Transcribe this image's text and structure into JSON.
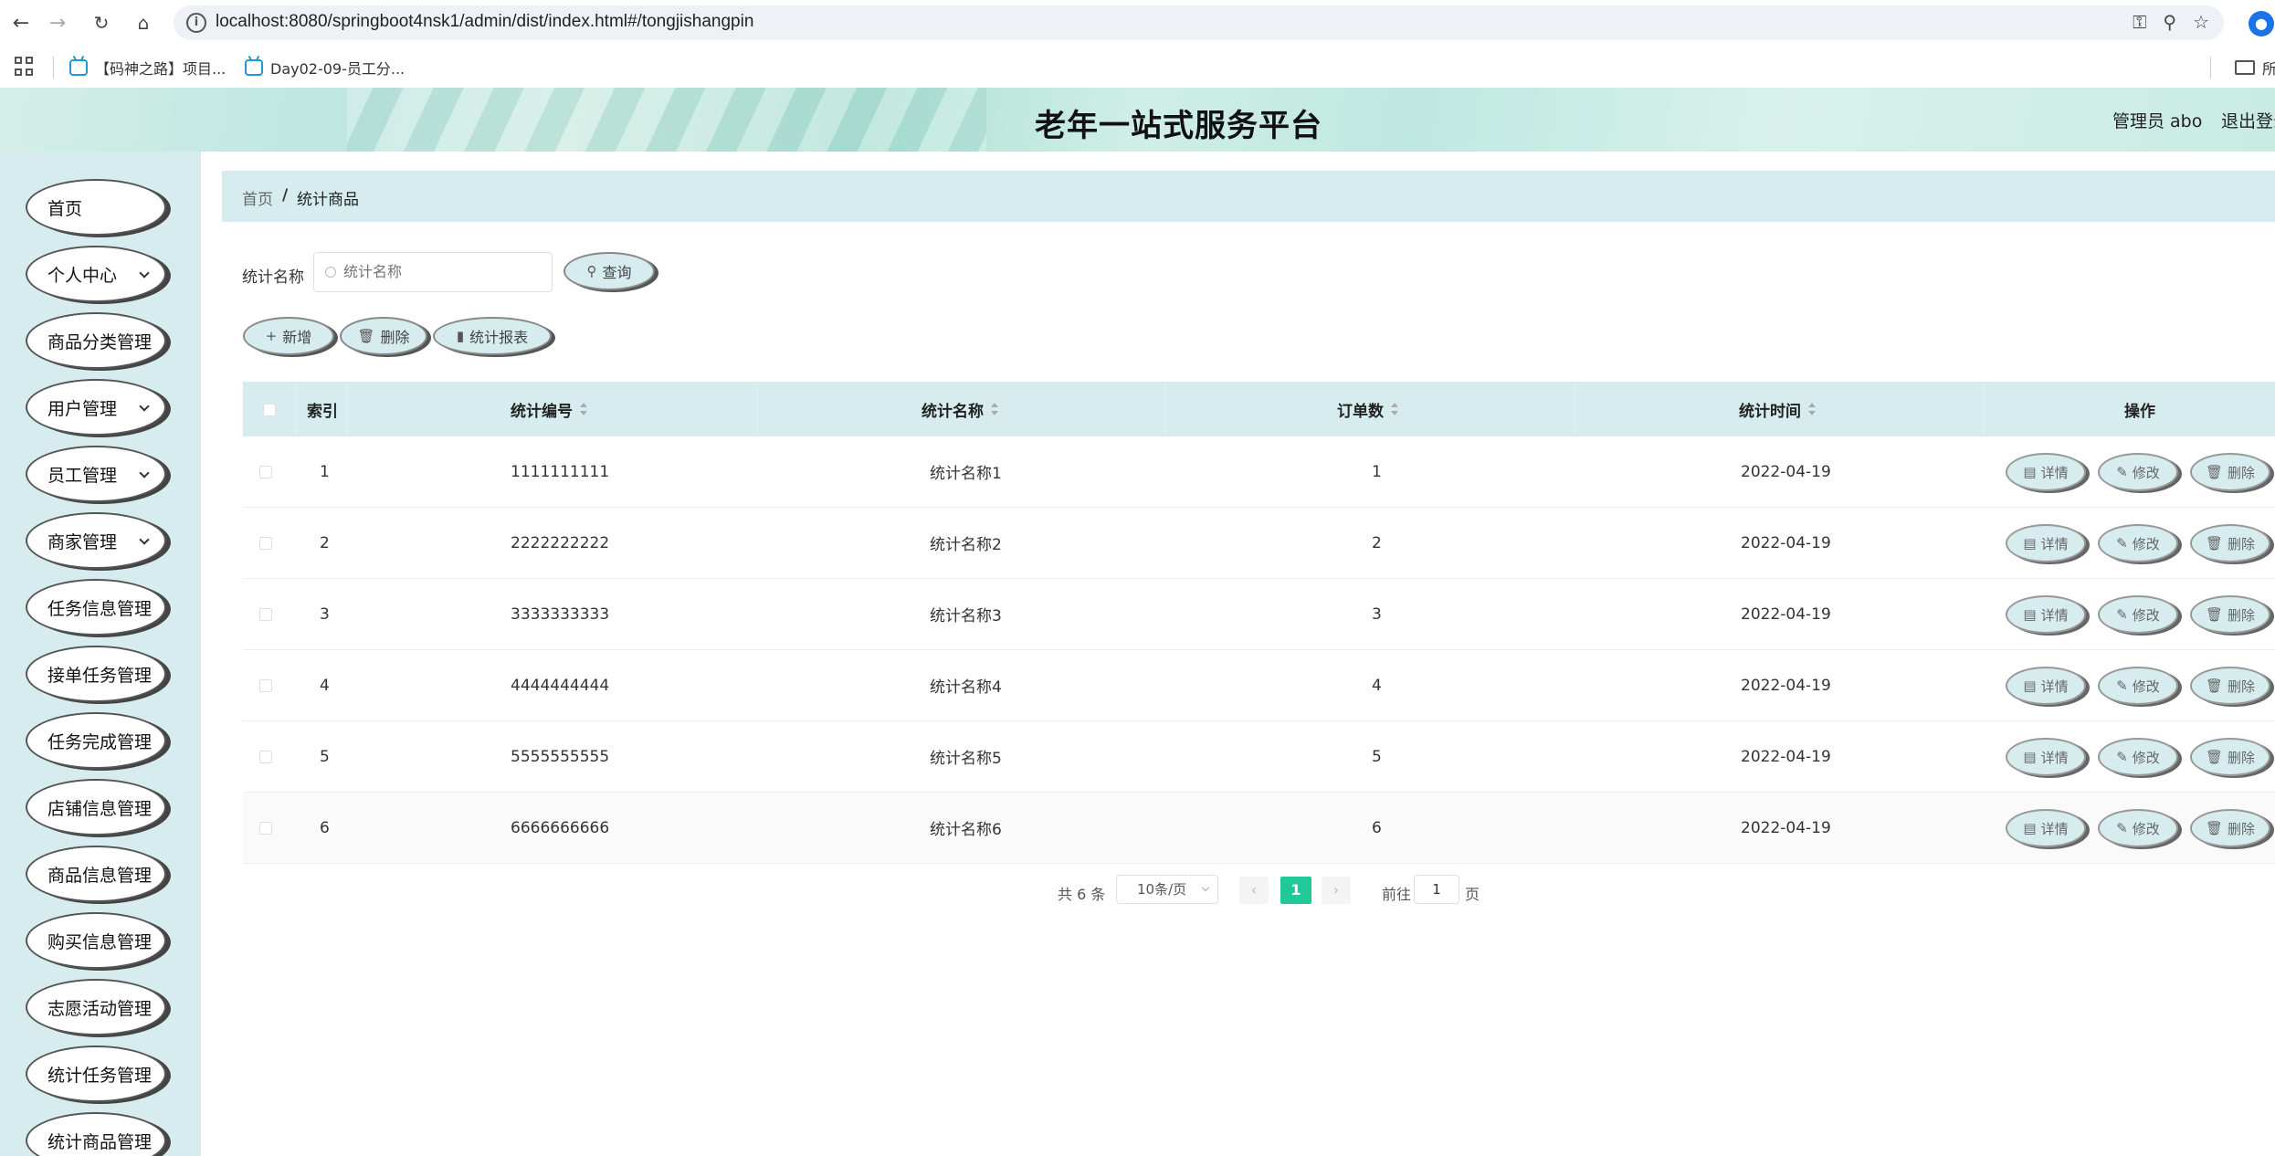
{
  "browser": {
    "url": "localhost:8080/springboot4nsk1/admin/dist/index.html#/tongjishangpin",
    "bookmarks": [
      "【码神之路】项目...",
      "Day02-09-员工分..."
    ],
    "bookmark_folder": "所"
  },
  "header": {
    "title": "老年一站式服务平台",
    "admin": "管理员 abo",
    "logout": "退出登录"
  },
  "sidebar": {
    "items": [
      {
        "label": "首页",
        "expandable": false
      },
      {
        "label": "个人中心",
        "expandable": true
      },
      {
        "label": "商品分类管理",
        "expandable": false
      },
      {
        "label": "用户管理",
        "expandable": true
      },
      {
        "label": "员工管理",
        "expandable": true
      },
      {
        "label": "商家管理",
        "expandable": true
      },
      {
        "label": "任务信息管理",
        "expandable": false
      },
      {
        "label": "接单任务管理",
        "expandable": false
      },
      {
        "label": "任务完成管理",
        "expandable": false
      },
      {
        "label": "店铺信息管理",
        "expandable": false
      },
      {
        "label": "商品信息管理",
        "expandable": false
      },
      {
        "label": "购买信息管理",
        "expandable": false
      },
      {
        "label": "志愿活动管理",
        "expandable": false
      },
      {
        "label": "统计任务管理",
        "expandable": false
      },
      {
        "label": "统计商品管理",
        "expandable": false
      }
    ]
  },
  "breadcrumb": {
    "home": "首页",
    "separator": "/",
    "current": "统计商品"
  },
  "search": {
    "label": "统计名称",
    "placeholder": "统计名称",
    "button": "查询"
  },
  "toolbar": {
    "add": "新增",
    "delete": "删除",
    "report": "统计报表"
  },
  "table": {
    "headers": {
      "index": "索引",
      "code": "统计编号",
      "name": "统计名称",
      "orders": "订单数",
      "time": "统计时间",
      "ops": "操作"
    },
    "rows": [
      {
        "index": "1",
        "code": "1111111111",
        "name": "统计名称1",
        "orders": "1",
        "time": "2022-04-19"
      },
      {
        "index": "2",
        "code": "2222222222",
        "name": "统计名称2",
        "orders": "2",
        "time": "2022-04-19"
      },
      {
        "index": "3",
        "code": "3333333333",
        "name": "统计名称3",
        "orders": "3",
        "time": "2022-04-19"
      },
      {
        "index": "4",
        "code": "4444444444",
        "name": "统计名称4",
        "orders": "4",
        "time": "2022-04-19"
      },
      {
        "index": "5",
        "code": "5555555555",
        "name": "统计名称5",
        "orders": "5",
        "time": "2022-04-19"
      },
      {
        "index": "6",
        "code": "6666666666",
        "name": "统计名称6",
        "orders": "6",
        "time": "2022-04-19"
      }
    ],
    "actions": {
      "detail": "详情",
      "edit": "修改",
      "delete": "删除"
    }
  },
  "pagination": {
    "total": "共 6 条",
    "page_size": "10条/页",
    "current": "1",
    "goto_label": "前往",
    "goto_value": "1",
    "goto_unit": "页"
  },
  "colors": {
    "accent": "#20c997",
    "panel": "#d6ecee"
  }
}
